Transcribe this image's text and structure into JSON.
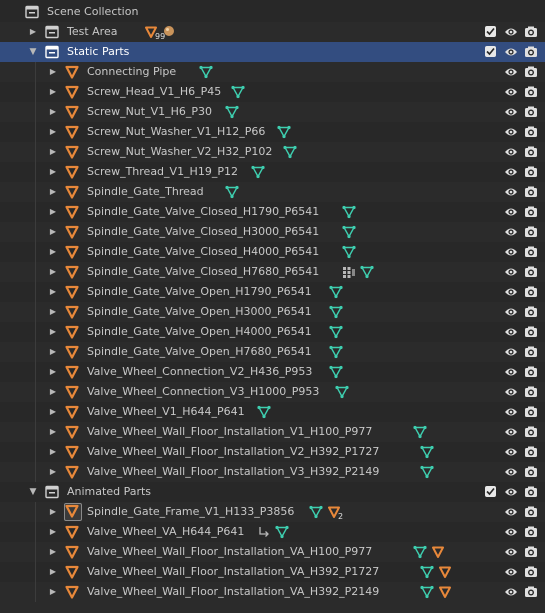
{
  "outliner": {
    "root_label": "Scene Collection",
    "collections": [
      {
        "label": "Test Area",
        "expanded": false,
        "selected": false,
        "included": true,
        "badge": "99",
        "objects": []
      },
      {
        "label": "Static Parts",
        "expanded": true,
        "selected": true,
        "included": true,
        "objects": [
          {
            "label": "Connecting Pipe",
            "data_icons": [
              "mesh-data-icon"
            ]
          },
          {
            "label": "Screw_Head_V1_H6_P45",
            "data_icons": [
              "mesh-data-icon"
            ]
          },
          {
            "label": "Screw_Nut_V1_H6_P30",
            "data_icons": [
              "mesh-data-icon"
            ]
          },
          {
            "label": "Screw_Nut_Washer_V1_H12_P66",
            "data_icons": [
              "mesh-data-icon"
            ]
          },
          {
            "label": "Screw_Nut_Washer_V2_H32_P102",
            "data_icons": [
              "mesh-data-icon"
            ]
          },
          {
            "label": "Screw_Thread_V1_H19_P12",
            "data_icons": [
              "mesh-data-icon"
            ]
          },
          {
            "label": "Spindle_Gate_Thread",
            "data_icons": [
              "mesh-data-icon"
            ]
          },
          {
            "label": "Spindle_Gate_Valve_Closed_H1790_P6541",
            "data_icons": [
              "mesh-data-icon"
            ]
          },
          {
            "label": "Spindle_Gate_Valve_Closed_H3000_P6541",
            "data_icons": [
              "mesh-data-icon"
            ]
          },
          {
            "label": "Spindle_Gate_Valve_Closed_H4000_P6541",
            "data_icons": [
              "mesh-data-icon"
            ]
          },
          {
            "label": "Spindle_Gate_Valve_Closed_H7680_P6541",
            "data_icons": [
              "modifier-icon",
              "mesh-data-icon"
            ]
          },
          {
            "label": "Spindle_Gate_Valve_Open_H1790_P6541",
            "data_icons": [
              "mesh-data-icon"
            ]
          },
          {
            "label": "Spindle_Gate_Valve_Open_H3000_P6541",
            "data_icons": [
              "mesh-data-icon"
            ]
          },
          {
            "label": "Spindle_Gate_Valve_Open_H4000_P6541",
            "data_icons": [
              "mesh-data-icon"
            ]
          },
          {
            "label": "Spindle_Gate_Valve_Open_H7680_P6541",
            "data_icons": [
              "mesh-data-icon"
            ]
          },
          {
            "label": "Valve_Wheel_Connection_V2_H436_P953",
            "data_icons": [
              "mesh-data-icon"
            ]
          },
          {
            "label": "Valve_Wheel_Connection_V3_H1000_P953",
            "data_icons": [
              "mesh-data-icon"
            ]
          },
          {
            "label": "Valve_Wheel_V1_H644_P641",
            "data_icons": [
              "mesh-data-icon"
            ]
          },
          {
            "label": "Valve_Wheel_Wall_Floor_Installation_V1_H100_P977",
            "data_icons": [
              "mesh-data-icon"
            ]
          },
          {
            "label": "Valve_Wheel_Wall_Floor_Installation_V2_H392_P1727",
            "data_icons": [
              "mesh-data-icon"
            ]
          },
          {
            "label": "Valve_Wheel_Wall_Floor_Installation_V3_H392_P2149",
            "data_icons": [
              "mesh-data-icon"
            ]
          }
        ]
      },
      {
        "label": "Animated Parts",
        "expanded": true,
        "selected": false,
        "included": true,
        "objects": [
          {
            "label": "Spindle_Gate_Frame_V1_H133_P3856",
            "data_icons": [
              "mesh-data-icon",
              "child-object-icon"
            ],
            "badge": "2",
            "active": true
          },
          {
            "label": "Valve_Wheel_VA_H644_P641",
            "data_icons": [
              "parent-link-icon",
              "mesh-data-icon"
            ]
          },
          {
            "label": "Valve_Wheel_Wall_Floor_Installation_VA_H100_P977",
            "data_icons": [
              "mesh-data-icon",
              "child-object-icon"
            ]
          },
          {
            "label": "Valve_Wheel_Wall_Floor_Installation_VA_H392_P1727",
            "data_icons": [
              "mesh-data-icon",
              "child-object-icon"
            ]
          },
          {
            "label": "Valve_Wheel_Wall_Floor_Installation_VA_H392_P2149",
            "data_icons": [
              "mesh-data-icon",
              "child-object-icon"
            ]
          }
        ]
      }
    ]
  },
  "colors": {
    "background": "#282828",
    "selected_row": "#334d80",
    "object_icon": "#e8883a",
    "mesh_data_icon": "#3ecfb0",
    "text": "#c8c8c8"
  }
}
